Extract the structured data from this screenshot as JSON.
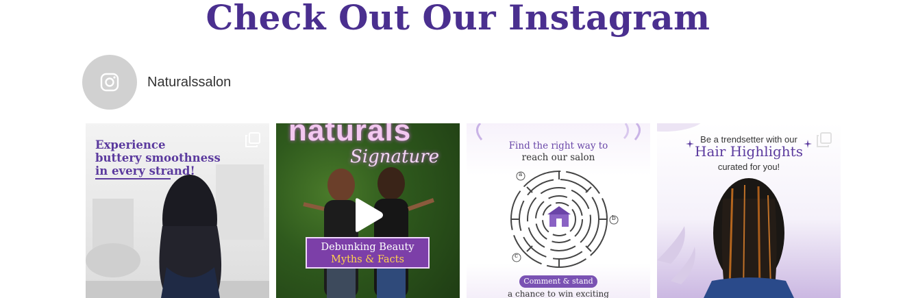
{
  "section": {
    "title": "Check Out Our Instagram"
  },
  "profile": {
    "username": "Naturalssalon",
    "avatar_icon": "instagram-icon"
  },
  "posts": [
    {
      "kind": "carousel",
      "lines": [
        "Experience",
        "buttery smoothness",
        "in every strand!"
      ],
      "icon": "multiple-images-icon"
    },
    {
      "kind": "video",
      "brand": "naturals",
      "signature": "Signature",
      "box_line1": "Debunking Beauty",
      "box_line2": "Myths & Facts",
      "icon": "play-icon"
    },
    {
      "kind": "image",
      "line1": "Find the right way to",
      "line2": "reach our salon",
      "maze_labels": [
        "a",
        "b",
        "c"
      ],
      "pill": "Comment & stand",
      "footer": "a chance to win exciting"
    },
    {
      "kind": "carousel",
      "line1": "Be a trendsetter with our",
      "line2": "Hair Highlights",
      "line3": "curated for you!",
      "icon": "multiple-images-icon"
    }
  ],
  "colors": {
    "title": "#4a2f8f",
    "accent": "#5b3a9e",
    "avatar_bg": "#d1d1d1"
  }
}
